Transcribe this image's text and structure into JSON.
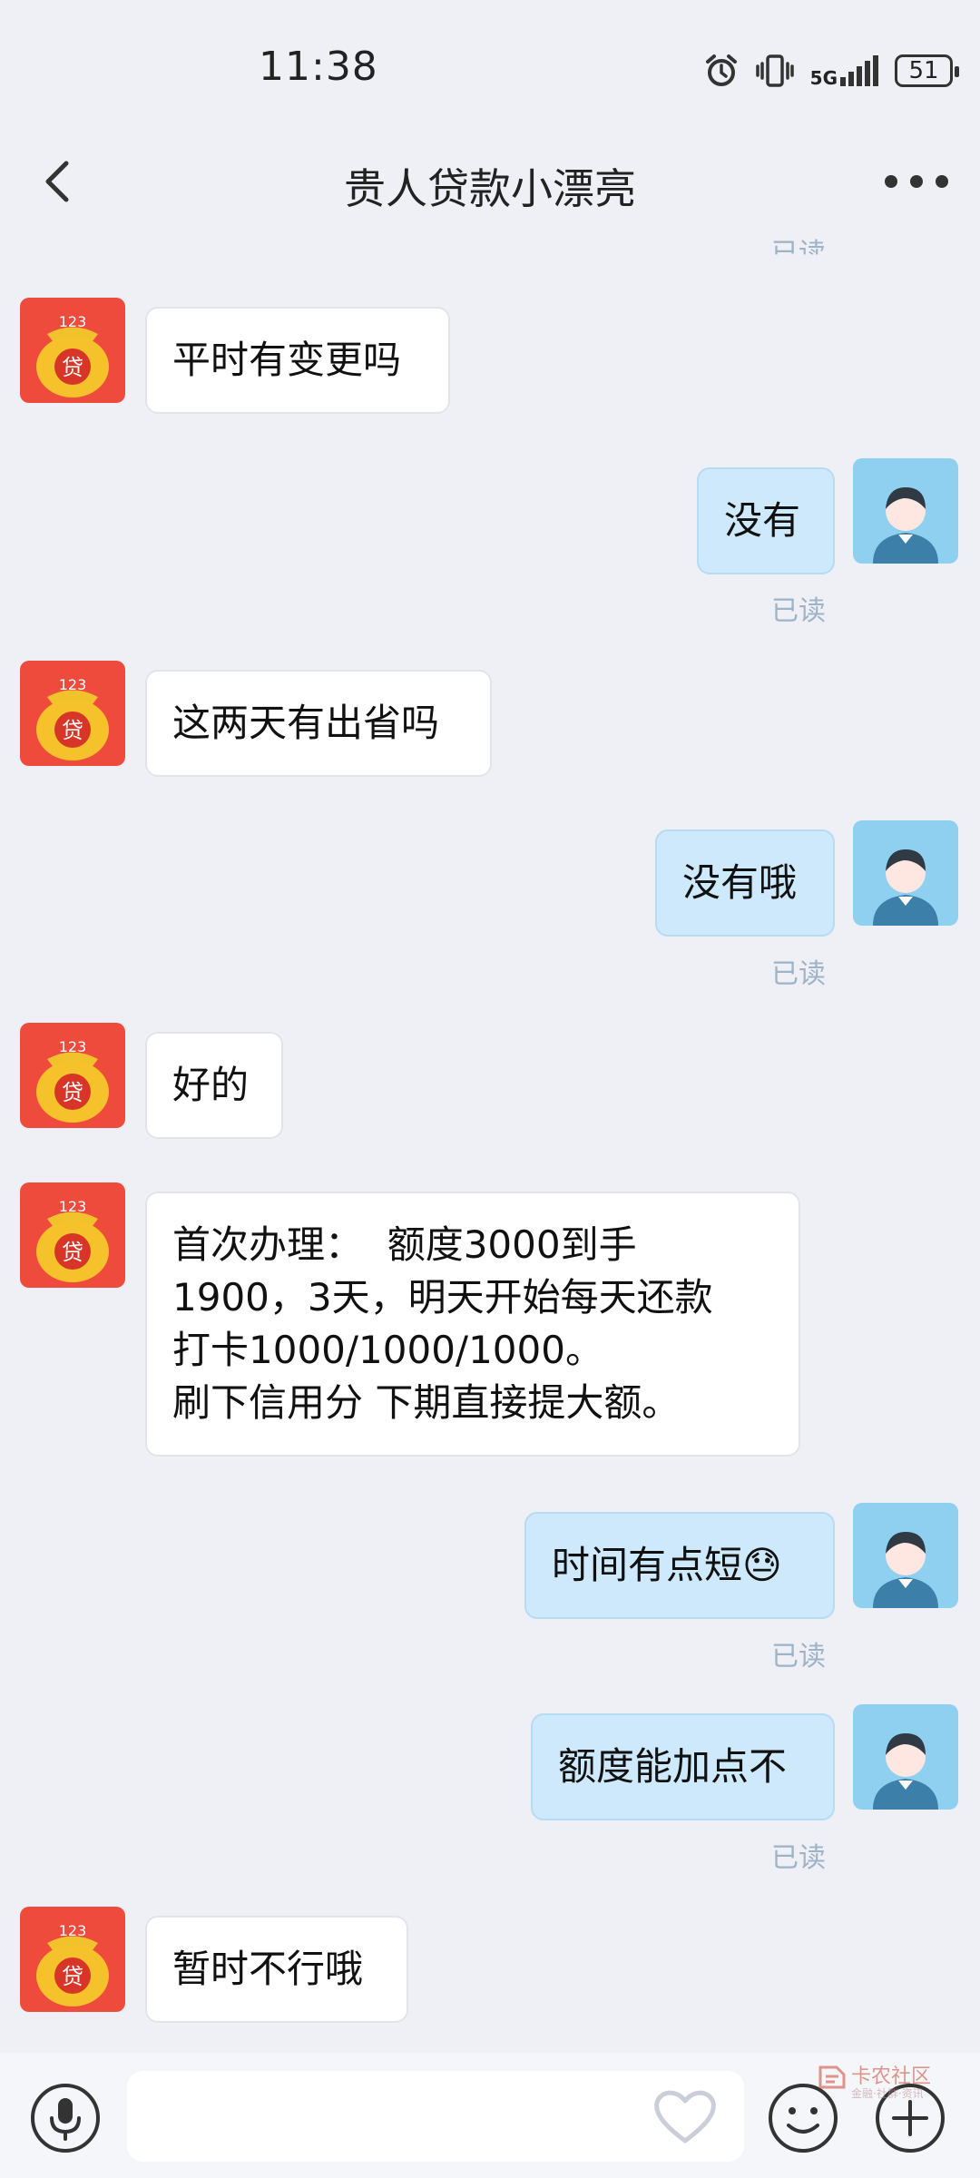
{
  "status": {
    "time": "11:38",
    "battery": "51",
    "network": "5G"
  },
  "header": {
    "title": "贵人贷款小漂亮"
  },
  "read_label": "已读",
  "contact_avatar": {
    "top_text": "123",
    "center_text": "贷"
  },
  "messages": [
    {
      "side": "left",
      "text": "平时有变更吗"
    },
    {
      "side": "right",
      "text": "没有",
      "status": "已读"
    },
    {
      "side": "left",
      "text": "这两天有出省吗"
    },
    {
      "side": "right",
      "text": "没有哦",
      "status": "已读"
    },
    {
      "side": "left",
      "text": "好的"
    },
    {
      "side": "left",
      "text": "首次办理：  额度3000到手\n1900，3天，明天开始每天还款\n打卡1000/1000/1000。\n刷下信用分 下期直接提大额。"
    },
    {
      "side": "right",
      "text": "时间有点短😓",
      "status": "已读"
    },
    {
      "side": "right",
      "text": "额度能加点不",
      "status": "已读"
    },
    {
      "side": "left",
      "text": "暂时不行哦"
    }
  ],
  "input": {
    "value": "",
    "placeholder": ""
  },
  "watermark": {
    "title": "卡农社区",
    "subtitle": "金融·社群·资讯"
  },
  "icons": {
    "back": "chevron-left-icon",
    "more": "more-dots-icon",
    "mic": "microphone-icon",
    "heart": "heart-icon",
    "emoji": "smile-icon",
    "plus": "plus-icon"
  },
  "colors": {
    "self_bubble": "#cde9fb",
    "other_bubble": "#ffffff",
    "read": "#9fb3c8",
    "background": "#eef0f5"
  }
}
